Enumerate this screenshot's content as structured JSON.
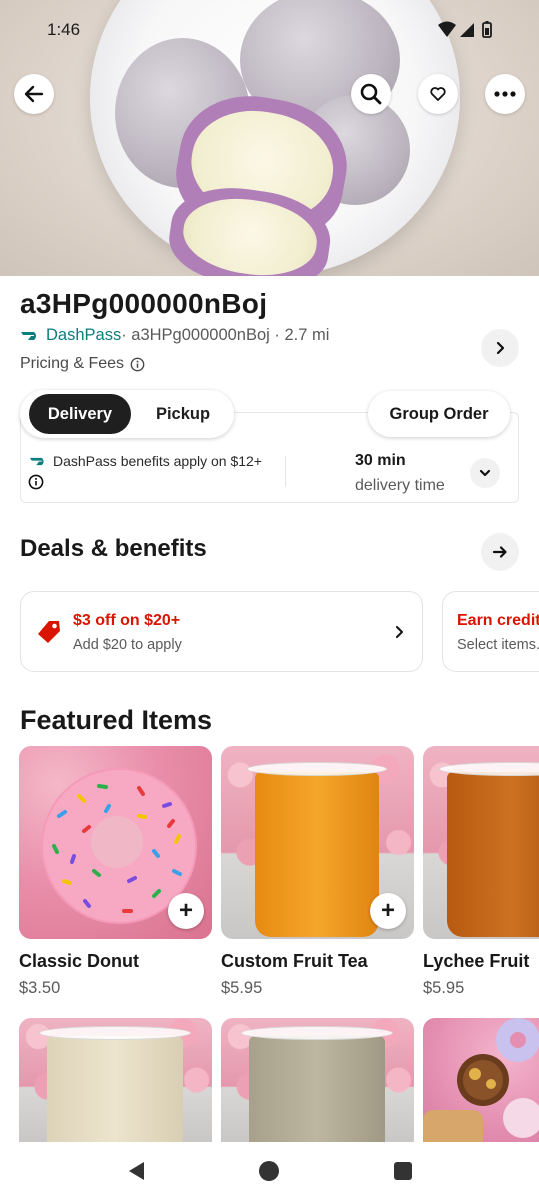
{
  "status_bar": {
    "time": "1:46"
  },
  "hero": {
    "image": "mochi-plate-photo"
  },
  "header_actions": {
    "back": "back-arrow-icon",
    "search": "search-icon",
    "favorite": "heart-icon",
    "more": "more-dots-icon"
  },
  "store": {
    "name": "a3HPg000000nBoj",
    "dashpass_label": "DashPass",
    "meta": " · a3HPg000000nBoj · 2.7 mi",
    "pricing_label": "Pricing & Fees"
  },
  "fulfillment": {
    "options": [
      "Delivery",
      "Pickup"
    ],
    "selected": "Delivery",
    "group_order": "Group Order",
    "dashpass_benefit": "DashPass benefits apply on $12+",
    "delivery_time": "30 min",
    "delivery_time_label": "delivery time"
  },
  "deals": {
    "title": "Deals & benefits",
    "cards": [
      {
        "title": "$3 off on $20+",
        "subtitle": "Add $20 to apply"
      },
      {
        "title": "Earn credit",
        "subtitle": "Select items."
      }
    ]
  },
  "featured": {
    "title": "Featured Items",
    "items": [
      {
        "name": "Classic Donut",
        "price": "$3.50"
      },
      {
        "name": "Custom Fruit Tea",
        "price": "$5.95"
      },
      {
        "name": "Lychee Fruit",
        "price": "$5.95"
      }
    ],
    "add_label": "+"
  },
  "colors": {
    "accent_red": "#d91400",
    "dashpass_teal": "#0b7e7e",
    "dark": "#1f1f1f"
  }
}
